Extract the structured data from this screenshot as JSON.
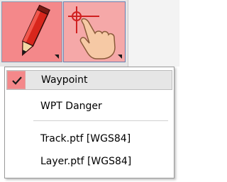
{
  "toolbar": {
    "tools": [
      {
        "name": "pencil",
        "icon": "pencil-icon",
        "color": "#f4888a"
      },
      {
        "name": "touch",
        "icon": "touch-pointer-icon",
        "color": "#f5a8a8"
      }
    ]
  },
  "menu": {
    "items": [
      {
        "label": "Waypoint",
        "checked": true
      },
      {
        "label": "WPT Danger",
        "checked": false
      },
      {
        "label": "Track.ptf [WGS84]",
        "checked": false
      },
      {
        "label": "Layer.ptf [WGS84]",
        "checked": false
      }
    ],
    "check_icon": "checkmark-icon"
  },
  "colors": {
    "accent": "#f4888a",
    "selected_bg": "#e6e6e6"
  }
}
